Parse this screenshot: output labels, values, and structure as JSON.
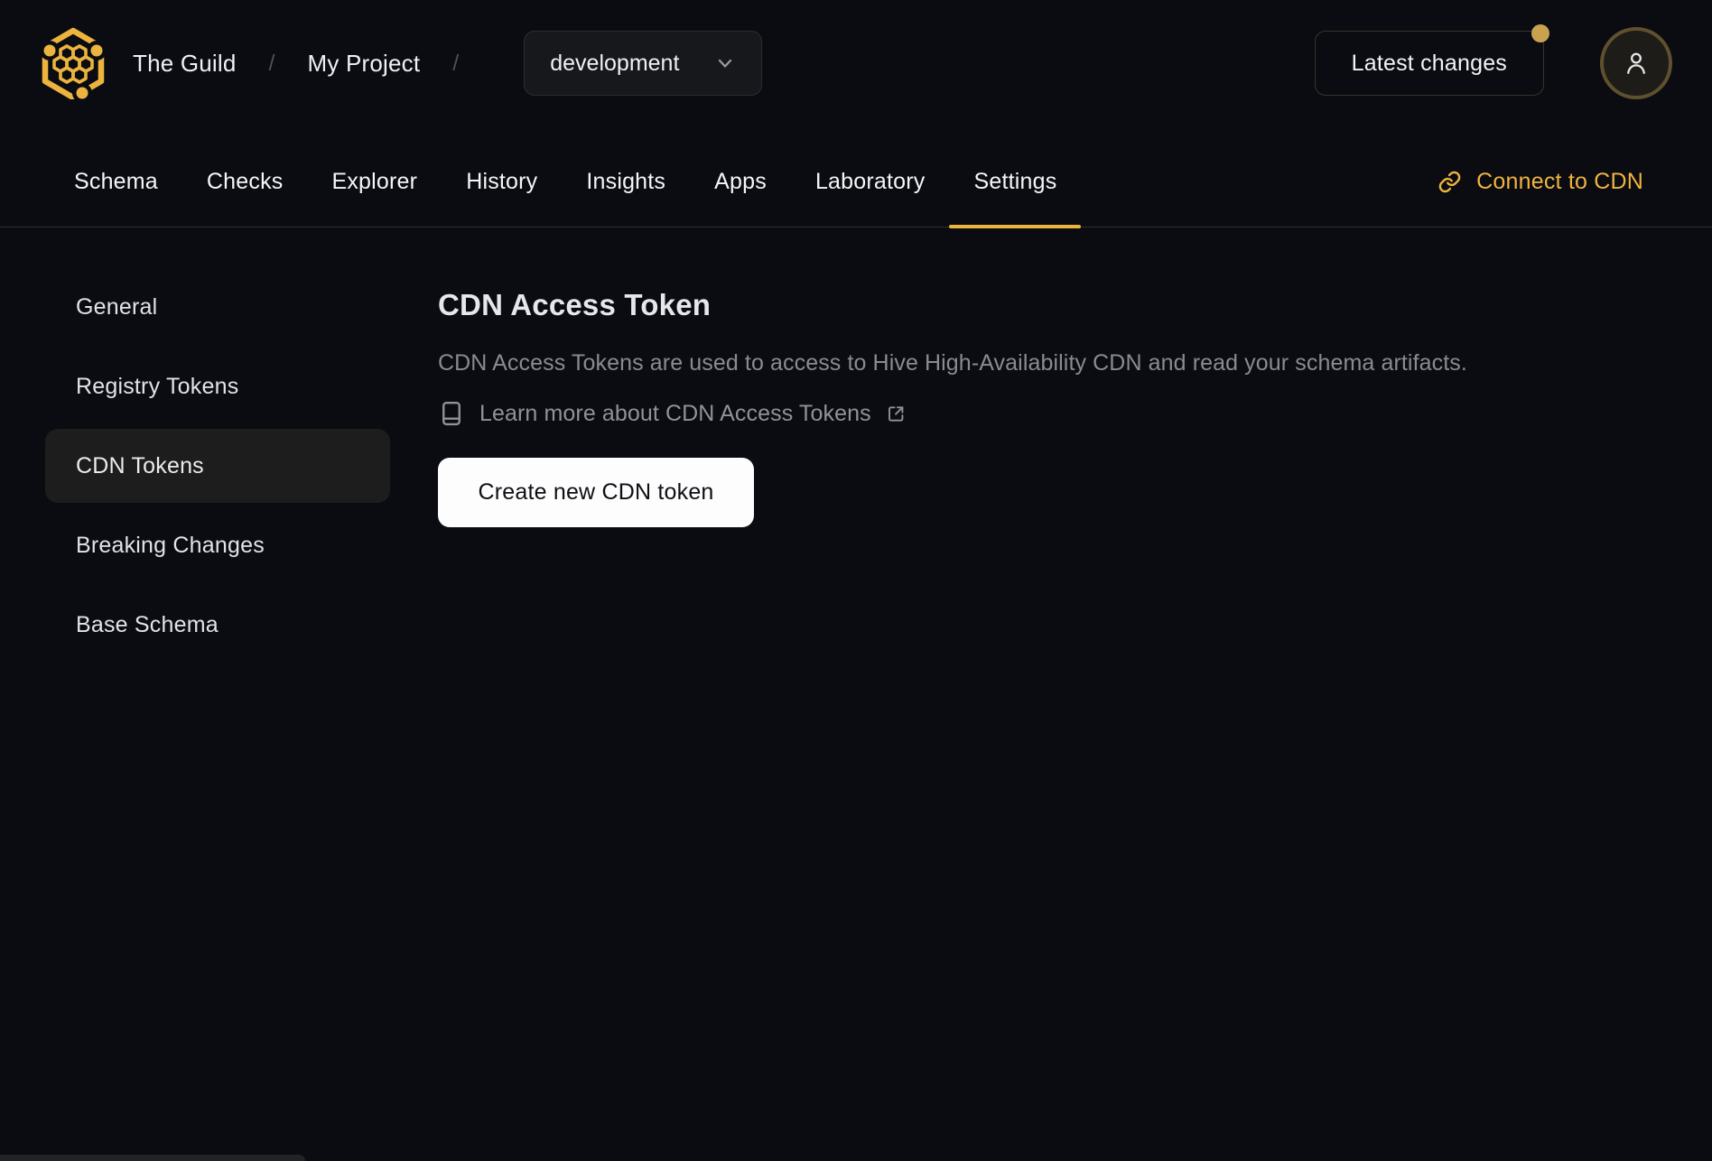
{
  "header": {
    "breadcrumb": {
      "org": "The Guild",
      "separator1": "/",
      "project": "My Project",
      "separator2": "/"
    },
    "target_selector": {
      "value": "development"
    },
    "latest_changes_label": "Latest changes"
  },
  "nav": {
    "tabs": [
      {
        "label": "Schema",
        "active": false
      },
      {
        "label": "Checks",
        "active": false
      },
      {
        "label": "Explorer",
        "active": false
      },
      {
        "label": "History",
        "active": false
      },
      {
        "label": "Insights",
        "active": false
      },
      {
        "label": "Apps",
        "active": false
      },
      {
        "label": "Laboratory",
        "active": false
      },
      {
        "label": "Settings",
        "active": true
      }
    ],
    "connect_cdn_label": "Connect to CDN"
  },
  "sidebar": {
    "items": [
      {
        "label": "General",
        "active": false
      },
      {
        "label": "Registry Tokens",
        "active": false
      },
      {
        "label": "CDN Tokens",
        "active": true
      },
      {
        "label": "Breaking Changes",
        "active": false
      },
      {
        "label": "Base Schema",
        "active": false
      }
    ]
  },
  "main": {
    "title": "CDN Access Token",
    "description": "CDN Access Tokens are used to access to Hive High-Availability CDN and read your schema artifacts.",
    "learn_more_label": "Learn more about CDN Access Tokens",
    "create_button_label": "Create new CDN token"
  },
  "colors": {
    "background": "#0a0c11",
    "accent_gold": "#ecb43e",
    "active_item_bg": "#1d1d1d",
    "notification_dot": "#c9a250",
    "button_bg": "#fdfdfe",
    "divider": "#332d26"
  }
}
